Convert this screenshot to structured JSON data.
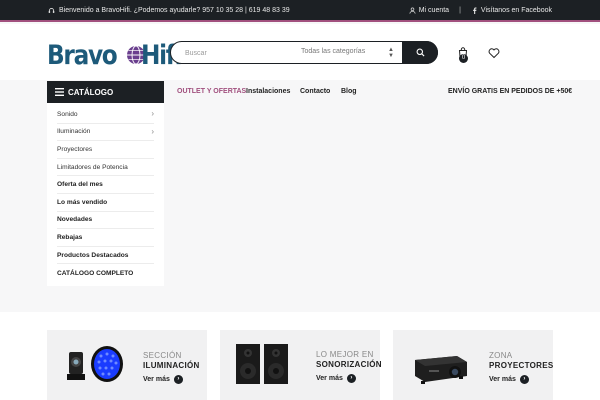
{
  "topbar": {
    "welcome": "Bienvenido a BravoHifi. ¿Podemos ayudarle? 957 10 35 28 | 619 48 83 39",
    "account": "Mi cuenta",
    "separator": "|",
    "facebook": "Visítanos en Facebook"
  },
  "header": {
    "logo_left": "Bravo",
    "logo_right": "Hifi",
    "search_placeholder": "Buscar",
    "category_select": "Todas las categorías",
    "cart_count": "0"
  },
  "catalog": {
    "title": "CATÁLOGO",
    "items": [
      {
        "label": "Sonido"
      },
      {
        "label": "Iluminación"
      },
      {
        "label": "Proyectores"
      },
      {
        "label": "Limitadores de Potencia"
      },
      {
        "label": "Oferta del mes"
      },
      {
        "label": "Lo más vendido"
      },
      {
        "label": "Novedades"
      },
      {
        "label": "Rebajas"
      },
      {
        "label": "Productos Destacados"
      },
      {
        "label": "CATÁLOGO COMPLETO"
      }
    ]
  },
  "nav": {
    "outlet": "OUTLET Y OFERTAS",
    "installations": "Instalaciones",
    "contact": "Contacto",
    "blog": "Blog",
    "free_shipping": "ENVÍO GRATIS EN PEDIDOS DE +50€"
  },
  "promos": [
    {
      "line1": "SECCIÓN",
      "line2": "ILUMINACIÓN",
      "cta": "Ver más"
    },
    {
      "line1": "LO MEJOR EN",
      "line2": "SONORIZACIÓN",
      "cta": "Ver más"
    },
    {
      "line1": "ZONA",
      "line2": "PROYECTORES",
      "cta": "Ver más"
    }
  ],
  "colors": {
    "dark": "#1c2024",
    "accent": "#a1507e",
    "logo_blue": "#1d5a7a"
  }
}
